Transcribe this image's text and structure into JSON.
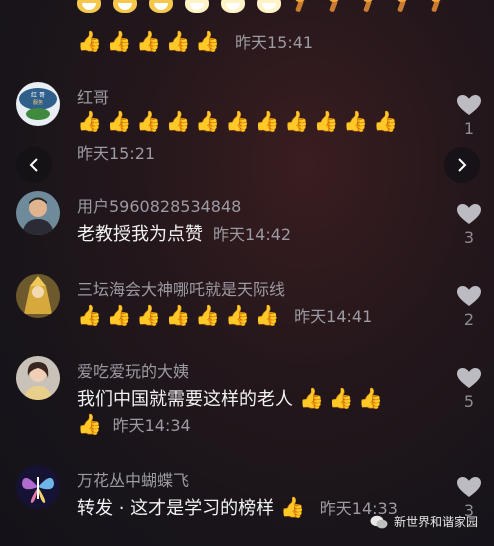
{
  "colors": {
    "username": "#9c9aa2",
    "text": "#f2f2f2",
    "like_icon": "#bdbbc2"
  },
  "top_comment": {
    "time": "昨天15:41"
  },
  "comments": [
    {
      "username": "红哥",
      "text": "",
      "time": "昨天15:21",
      "likes": "1"
    },
    {
      "username": "用户5960828534848",
      "text": "老教授我为点赞",
      "time": "昨天14:42",
      "likes": "3"
    },
    {
      "username": "三坛海会大神哪吒就是天际线",
      "text": "",
      "time": "昨天14:41",
      "likes": "2"
    },
    {
      "username": "爱吃爱玩的大姨",
      "text": "我们中国就需要这样的老人",
      "time": "昨天14:34",
      "likes": "5"
    },
    {
      "username": "万花丛中蝴蝶飞",
      "text": "转发 · 这才是学习的榜样",
      "time": "昨天14:33",
      "likes": "3"
    }
  ],
  "icons": {
    "prev": "chevron-left-icon",
    "next": "chevron-right-icon",
    "like": "heart-icon"
  },
  "watermark": {
    "label": "新世界和谐家园"
  }
}
